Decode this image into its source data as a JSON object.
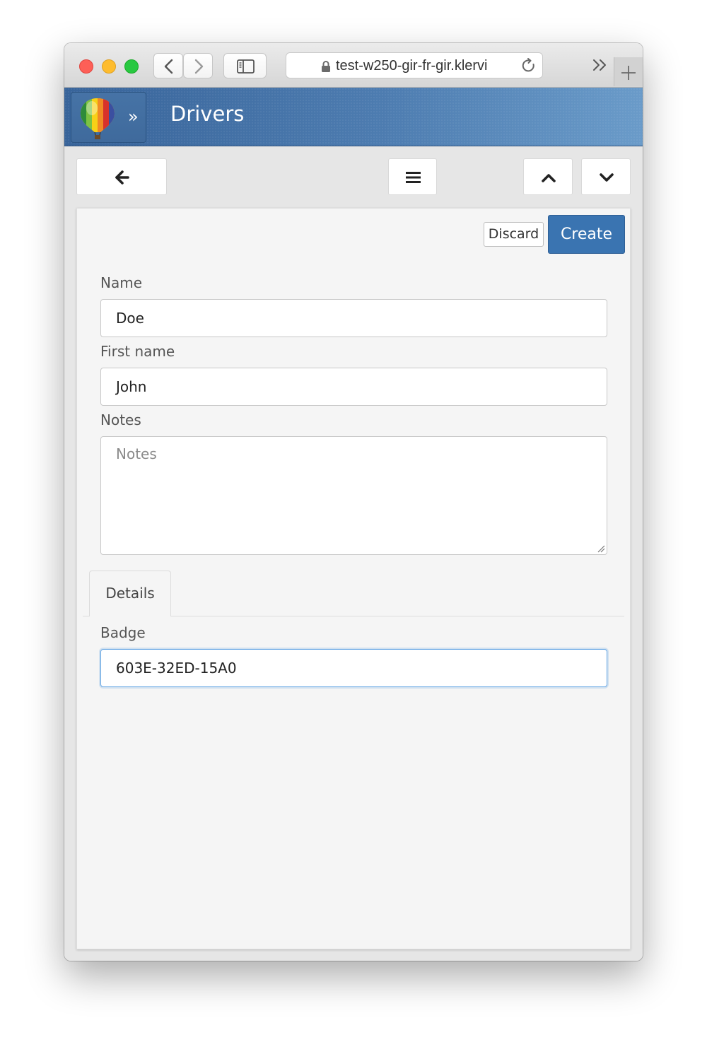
{
  "browser": {
    "url": "test-w250-gir-fr-gir.klervi",
    "buttons": {
      "back": "chevron-left-icon",
      "forward": "chevron-right-icon",
      "sidebar": "sidebar-icon",
      "reload": "reload-icon",
      "more": "double-chevron-right-icon",
      "new_tab": "plus-icon"
    }
  },
  "app": {
    "title": "Drivers",
    "breadcrumb_separator": "»",
    "logo": "hot-air-balloon-logo"
  },
  "toolbar": {
    "back": "arrow-left-icon",
    "menu": "hamburger-menu-icon",
    "previous": "chevron-up-icon",
    "next": "chevron-down-icon"
  },
  "form": {
    "discard_label": "Discard",
    "create_label": "Create",
    "name": {
      "label": "Name",
      "value": "Doe"
    },
    "first_name": {
      "label": "First name",
      "value": "John"
    },
    "notes": {
      "label": "Notes",
      "value": "",
      "placeholder": "Notes"
    },
    "tabs": [
      {
        "label": "Details",
        "active": true
      }
    ],
    "badge": {
      "label": "Badge",
      "value": "603E-32ED-15A0"
    }
  },
  "colors": {
    "primary": "#3a74b1",
    "header": "#4d7cb0",
    "focus": "#66a6e4"
  }
}
